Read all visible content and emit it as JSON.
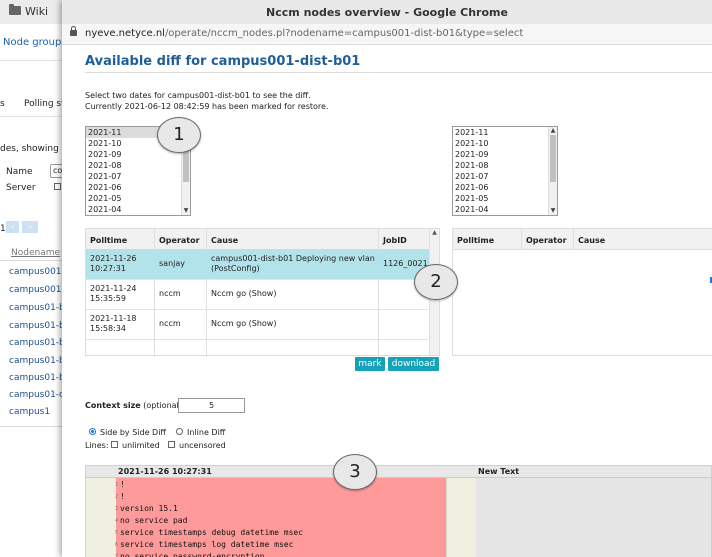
{
  "background": {
    "topbar": {
      "wiki_label": "Wiki",
      "lists_label": "Lis"
    },
    "nav_title": "Node groups",
    "tabs": [
      "s",
      "Polling st"
    ],
    "showing": "des, showing 9",
    "name_label": "Name",
    "name_value": "co",
    "server_label": "Server",
    "page_number": "1",
    "pager_buttons": [
      "‹",
      "‹‹"
    ],
    "col_header": "Nodename",
    "nodes": [
      "campus001-c",
      "campus001-c",
      "campus01-b0",
      "campus01-b0",
      "campus01-b0",
      "campus01-b0",
      "campus01-b0",
      "campus01-co",
      "campus1"
    ]
  },
  "window": {
    "title": "Nccm nodes overview - Google Chrome",
    "url_host": "nyeve.netyce.nl",
    "url_path": "/operate/nccm_nodes.pl?nodename=campus001-dist-b01&type=select"
  },
  "page": {
    "heading": "Available diff for campus001-dist-b01",
    "instruction": "Select two dates for campus001-dist-b01 to see the diff.",
    "restore_note": "Currently 2021-06-12 08:42:59 has been marked for restore."
  },
  "left_list": {
    "options": [
      "2021-11",
      "2021-10",
      "2021-09",
      "2021-08",
      "2021-07",
      "2021-06",
      "2021-05",
      "2021-04"
    ],
    "selected_index": 0
  },
  "right_list": {
    "options": [
      "2021-11",
      "2021-10",
      "2021-09",
      "2021-08",
      "2021-07",
      "2021-06",
      "2021-05",
      "2021-04"
    ]
  },
  "left_table": {
    "headers": [
      "Polltime",
      "Operator",
      "Cause",
      "JobID"
    ],
    "rows": [
      {
        "polltime": [
          "2021-11-26",
          "10:27:31"
        ],
        "operator": "sanjay",
        "cause": [
          "campus001-dist-b01 Deploying new vlan",
          "(PostConfig)"
        ],
        "jobid": "1126_0021",
        "selected": true
      },
      {
        "polltime": [
          "2021-11-24",
          "15:35:59"
        ],
        "operator": "nccm",
        "cause": [
          "Nccm go (Show)"
        ],
        "jobid": "",
        "selected": false
      },
      {
        "polltime": [
          "2021-11-18",
          "15:58:34"
        ],
        "operator": "nccm",
        "cause": [
          "Nccm go (Show)"
        ],
        "jobid": "",
        "selected": false
      }
    ]
  },
  "right_table": {
    "headers": [
      "Polltime",
      "Operator",
      "Cause"
    ]
  },
  "buttons": {
    "mark": "mark",
    "download": "download"
  },
  "context": {
    "label": "Context size",
    "optional": "(optional):",
    "value": "5"
  },
  "diff_mode": {
    "side_by_side": "Side by Side Diff",
    "inline": "Inline Diff",
    "selected": "side_by_side"
  },
  "lines": {
    "label": "Lines:",
    "unlimited": "unlimited",
    "uncensored": "uncensored"
  },
  "diff": {
    "left_header": "2021-11-26 10:27:31",
    "right_header": "New Text",
    "lines": [
      {
        "n": "1",
        "text": "!"
      },
      {
        "n": "2",
        "text": "!"
      },
      {
        "n": "3",
        "text": "version 15.1"
      },
      {
        "n": "4",
        "text": "no service pad"
      },
      {
        "n": "5",
        "text": "service timestamps debug datetime msec"
      },
      {
        "n": "6",
        "text": "service timestamps log datetime msec"
      },
      {
        "n": "7",
        "text": "no service password-encryption"
      }
    ],
    "removed_color": "#ff9a9a"
  },
  "callouts": [
    "1",
    "2",
    "3"
  ],
  "colors": {
    "accent": "#17a2b8",
    "heading": "#1f5f98",
    "selected_row": "#b3e3ea"
  }
}
